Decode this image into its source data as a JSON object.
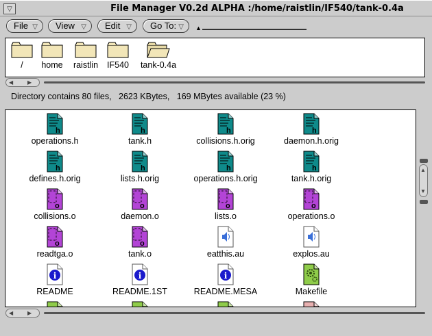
{
  "window": {
    "title": "File Manager V0.2d ALPHA :/home/raistlin/IF540/tank-0.4a"
  },
  "menubar": {
    "file_label": "File",
    "view_label": "View",
    "edit_label": "Edit",
    "goto_label": "Go To:"
  },
  "path": {
    "folders": [
      {
        "label": "/",
        "icon": "folder-icon"
      },
      {
        "label": "home",
        "icon": "folder-icon"
      },
      {
        "label": "raistlin",
        "icon": "folder-icon"
      },
      {
        "label": "IF540",
        "icon": "folder-icon"
      },
      {
        "label": "tank-0.4a",
        "icon": "open-folder-icon"
      }
    ]
  },
  "status": {
    "text": "Directory contains 80 files,   2623 KBytes,   169 MBytes available (23 %)"
  },
  "files": [
    {
      "name": "operations.h",
      "type": "header"
    },
    {
      "name": "tank.h",
      "type": "header"
    },
    {
      "name": "collisions.h.orig",
      "type": "header"
    },
    {
      "name": "daemon.h.orig",
      "type": "header"
    },
    {
      "name": "defines.h.orig",
      "type": "header"
    },
    {
      "name": "lists.h.orig",
      "type": "header"
    },
    {
      "name": "operations.h.orig",
      "type": "header"
    },
    {
      "name": "tank.h.orig",
      "type": "header"
    },
    {
      "name": "collisions.o",
      "type": "object"
    },
    {
      "name": "daemon.o",
      "type": "object"
    },
    {
      "name": "lists.o",
      "type": "object"
    },
    {
      "name": "operations.o",
      "type": "object"
    },
    {
      "name": "readtga.o",
      "type": "object"
    },
    {
      "name": "tank.o",
      "type": "object"
    },
    {
      "name": "eatthis.au",
      "type": "audio"
    },
    {
      "name": "explos.au",
      "type": "audio"
    },
    {
      "name": "README",
      "type": "info"
    },
    {
      "name": "README.1ST",
      "type": "info"
    },
    {
      "name": "README.MESA",
      "type": "info"
    },
    {
      "name": "Makefile",
      "type": "makefile"
    }
  ],
  "colors": {
    "header_icon": "#0f8a8a",
    "object_icon": "#b344d6",
    "info_icon": "#1a1acc",
    "makefile_icon": "#8fcc4a",
    "folder_fill": "#f2e6b8",
    "panel_bg": "#ffffff",
    "window_bg": "#cccccc"
  }
}
